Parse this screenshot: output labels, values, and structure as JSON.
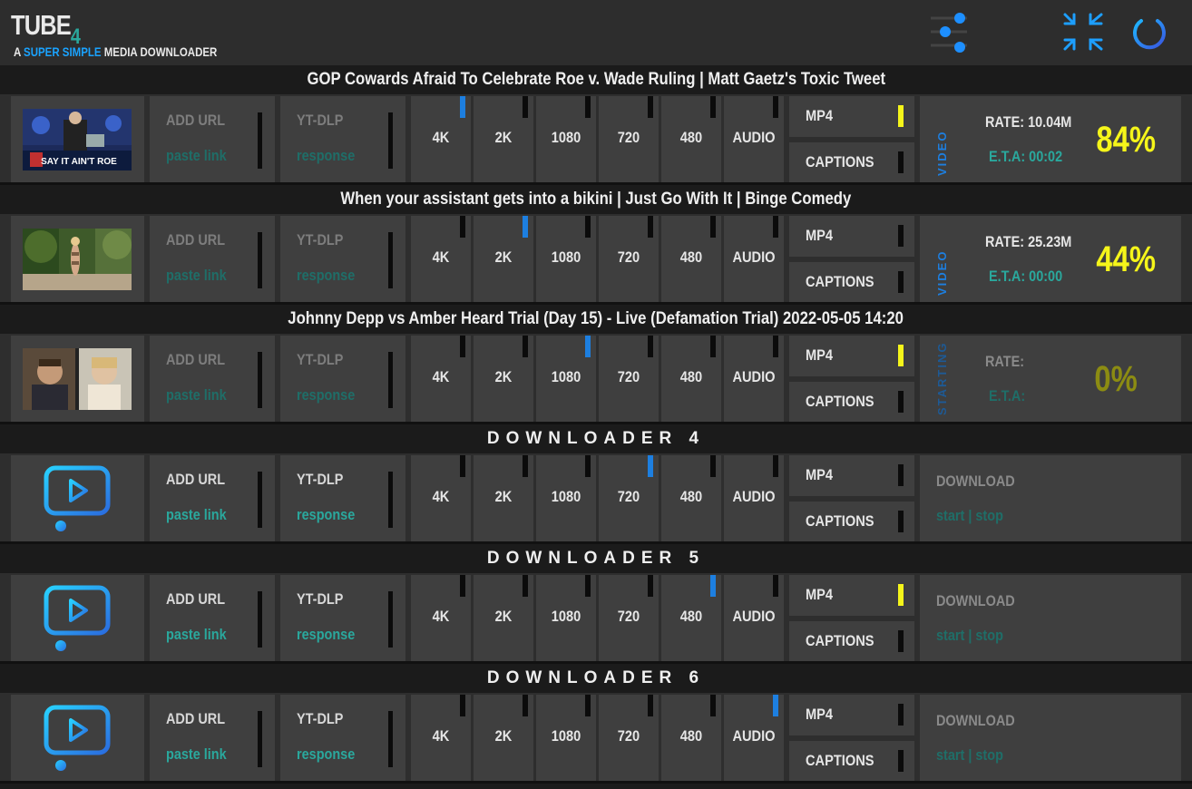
{
  "app": {
    "title": "TUBE",
    "title_suffix": "4",
    "subtitle_prefix": "A",
    "subtitle_highlight": "SUPER SIMPLE",
    "subtitle_rest": "MEDIA DOWNLOADER"
  },
  "header_icons": [
    "settings-sliders-icon",
    "minimize-arrows-icon",
    "power-icon"
  ],
  "colors": {
    "accent_blue": "#1d7fe0",
    "teal": "#2aa89d",
    "yellow": "#f5f51a"
  },
  "labels": {
    "add_url": "ADD URL",
    "paste_link": "paste link",
    "ytdlp": "YT-DLP",
    "response": "response",
    "resolutions": [
      "4K",
      "2K",
      "1080",
      "720",
      "480",
      "AUDIO"
    ],
    "mp4": "MP4",
    "captions": "CAPTIONS",
    "rate": "RATE:",
    "eta": "E.T.A:",
    "download": "DOWNLOAD",
    "start_stop": "start | stop"
  },
  "downloaders": [
    {
      "title": "GOP Cowards Afraid To Celebrate Roe v. Wade Ruling | Matt Gaetz's Toxic Tweet",
      "thumbnail": "thumbnail-late-show",
      "thumbnail_caption": "SAY IT AIN'T ROE",
      "selected_resolution": "4K",
      "mp4": true,
      "captions": false,
      "state": "VIDEO",
      "rate": "RATE: 10.04M",
      "eta": "E.T.A: 00:02",
      "percent": "84%"
    },
    {
      "title": "When your assistant gets into a bikini | Just Go With It | Binge Comedy",
      "thumbnail": "thumbnail-beach",
      "selected_resolution": "2K",
      "mp4": false,
      "captions": false,
      "state": "VIDEO",
      "rate": "RATE: 25.23M",
      "eta": "E.T.A: 00:00",
      "percent": "44%"
    },
    {
      "title": "Johnny Depp vs Amber Heard Trial (Day 15) - Live (Defamation Trial) 2022-05-05 14:20",
      "thumbnail": "thumbnail-trial",
      "selected_resolution": "1080",
      "mp4": true,
      "captions": false,
      "state": "STARTING",
      "rate": "RATE:",
      "eta": "E.T.A:",
      "percent": "0%"
    },
    {
      "title": "DOWNLOADER 4",
      "thumbnail": "video-player-icon",
      "selected_resolution": "720",
      "mp4": false,
      "captions": false,
      "state": "idle"
    },
    {
      "title": "DOWNLOADER 5",
      "thumbnail": "video-player-icon",
      "selected_resolution": "480",
      "mp4": true,
      "captions": false,
      "state": "idle"
    },
    {
      "title": "DOWNLOADER 6",
      "thumbnail": "video-player-icon",
      "selected_resolution": "AUDIO",
      "mp4": false,
      "captions": false,
      "state": "idle"
    }
  ]
}
